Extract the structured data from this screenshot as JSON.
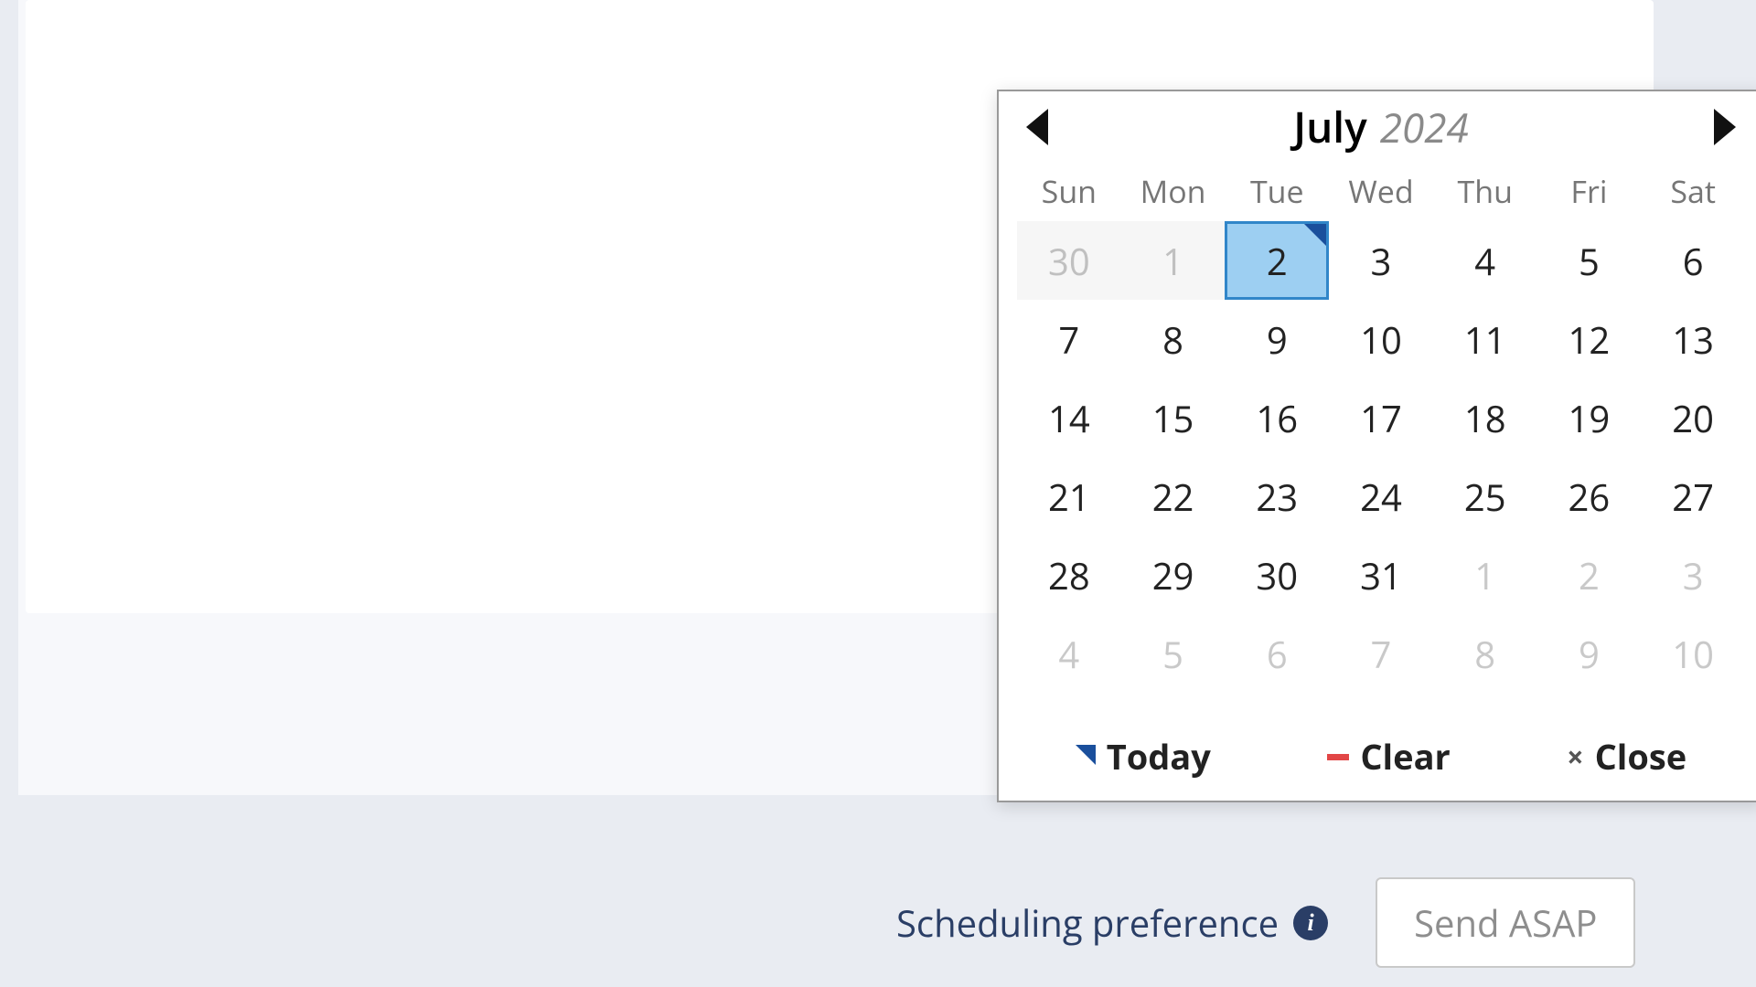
{
  "calendar": {
    "month": "July",
    "year": "2024",
    "dow": [
      "Sun",
      "Mon",
      "Tue",
      "Wed",
      "Thu",
      "Fri",
      "Sat"
    ],
    "weeks": [
      [
        {
          "n": "30",
          "state": "disabled"
        },
        {
          "n": "1",
          "state": "disabled"
        },
        {
          "n": "2",
          "state": "selected"
        },
        {
          "n": "3",
          "state": ""
        },
        {
          "n": "4",
          "state": ""
        },
        {
          "n": "5",
          "state": ""
        },
        {
          "n": "6",
          "state": ""
        }
      ],
      [
        {
          "n": "7",
          "state": ""
        },
        {
          "n": "8",
          "state": ""
        },
        {
          "n": "9",
          "state": ""
        },
        {
          "n": "10",
          "state": ""
        },
        {
          "n": "11",
          "state": ""
        },
        {
          "n": "12",
          "state": ""
        },
        {
          "n": "13",
          "state": ""
        }
      ],
      [
        {
          "n": "14",
          "state": ""
        },
        {
          "n": "15",
          "state": ""
        },
        {
          "n": "16",
          "state": ""
        },
        {
          "n": "17",
          "state": ""
        },
        {
          "n": "18",
          "state": ""
        },
        {
          "n": "19",
          "state": ""
        },
        {
          "n": "20",
          "state": ""
        }
      ],
      [
        {
          "n": "21",
          "state": ""
        },
        {
          "n": "22",
          "state": ""
        },
        {
          "n": "23",
          "state": ""
        },
        {
          "n": "24",
          "state": ""
        },
        {
          "n": "25",
          "state": ""
        },
        {
          "n": "26",
          "state": ""
        },
        {
          "n": "27",
          "state": ""
        }
      ],
      [
        {
          "n": "28",
          "state": ""
        },
        {
          "n": "29",
          "state": ""
        },
        {
          "n": "30",
          "state": ""
        },
        {
          "n": "31",
          "state": ""
        },
        {
          "n": "1",
          "state": "out"
        },
        {
          "n": "2",
          "state": "out"
        },
        {
          "n": "3",
          "state": "out"
        }
      ],
      [
        {
          "n": "4",
          "state": "out"
        },
        {
          "n": "5",
          "state": "out"
        },
        {
          "n": "6",
          "state": "out"
        },
        {
          "n": "7",
          "state": "out"
        },
        {
          "n": "8",
          "state": "out"
        },
        {
          "n": "9",
          "state": "out"
        },
        {
          "n": "10",
          "state": "out"
        }
      ]
    ],
    "actions": {
      "today": "Today",
      "clear": "Clear",
      "close": "Close"
    }
  },
  "schedule": {
    "label": "Scheduling preference",
    "button": "Send ASAP"
  }
}
